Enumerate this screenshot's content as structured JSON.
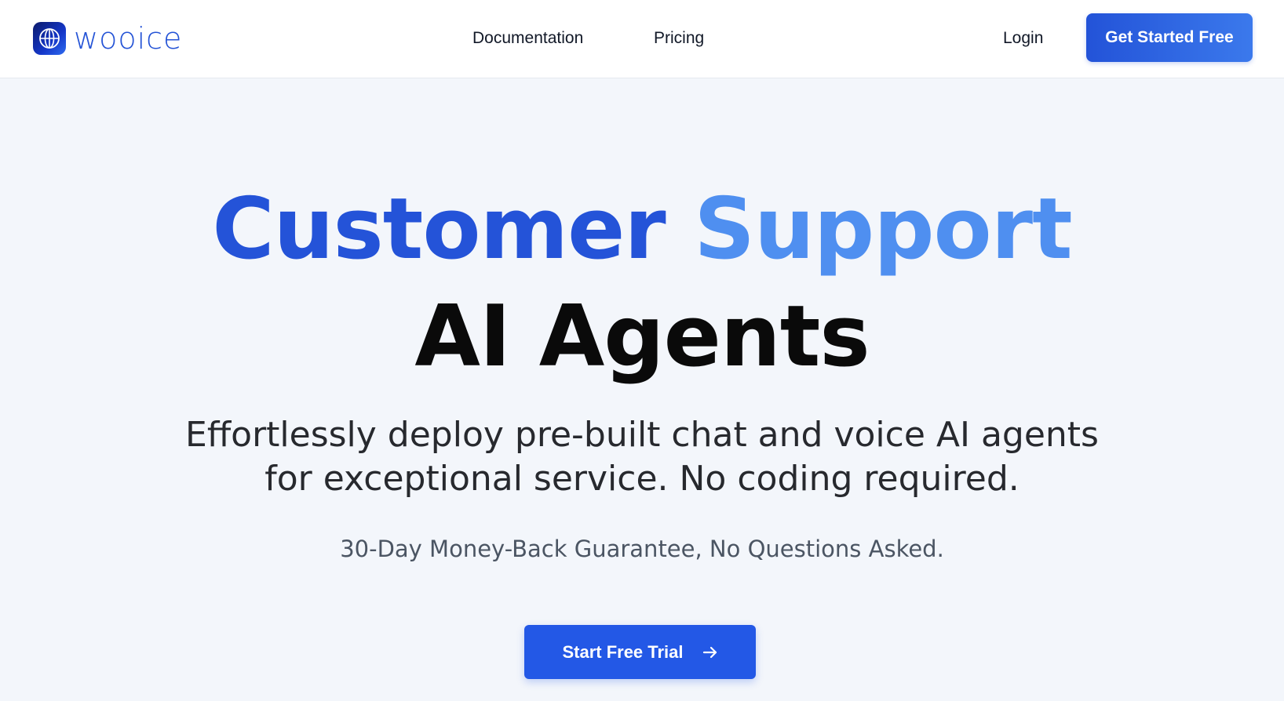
{
  "nav": {
    "logo_text": "wooice",
    "links": [
      "Documentation",
      "Pricing"
    ],
    "login_label": "Login",
    "cta_label": "Get Started Free"
  },
  "hero": {
    "headline_part1": "Customer",
    "headline_part2": "Support",
    "headline_line2": "AI Agents",
    "subtitle": "Effortlessly deploy pre-built chat and voice AI agents for exceptional service. No coding required.",
    "guarantee": "30-Day Money-Back Guarantee, No Questions Asked.",
    "cta_label": "Start Free Trial",
    "cta_icon": "arrow-right-icon"
  },
  "colors": {
    "brand_blue": "#2453d8",
    "brand_light_blue": "#4f8ff0",
    "background": "#f3f6fb"
  }
}
